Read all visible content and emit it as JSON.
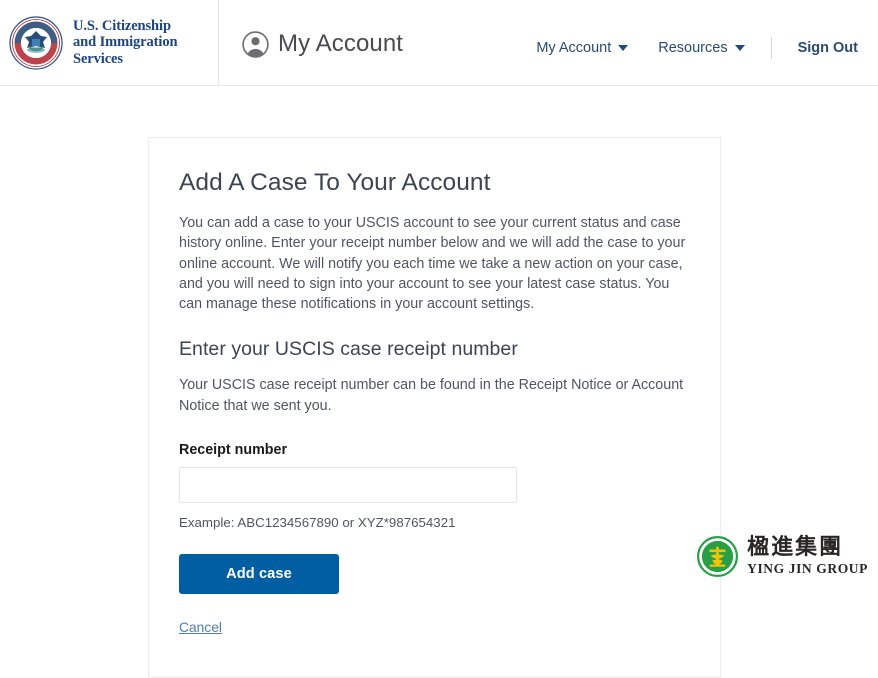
{
  "header": {
    "agency_name_line1": "U.S. Citizenship",
    "agency_name_line2": "and Immigration",
    "agency_name_line3": "Services",
    "seal_icon": "dhs-seal-icon",
    "account_title": "My Account",
    "account_icon": "user-avatar-icon",
    "nav": [
      {
        "label": "My Account",
        "has_dropdown": true,
        "icon": "chevron-down-icon"
      },
      {
        "label": "Resources",
        "has_dropdown": true,
        "icon": "chevron-down-icon"
      }
    ],
    "sign_out_label": "Sign Out"
  },
  "main": {
    "page_title": "Add A Case To Your Account",
    "intro_paragraph": "You can add a case to your USCIS account to see your current status and case history online. Enter your receipt number below and we will add the case to your online account. We will notify you each time we take a new action on your case, and you will need to sign into your account to see your latest case status. You can manage these notifications in your account settings.",
    "section_heading": "Enter your USCIS case receipt number",
    "section_paragraph": "Your USCIS case receipt number can be found in the Receipt Notice or Account Notice that we sent you.",
    "field_label": "Receipt number",
    "receipt_value": "",
    "receipt_placeholder": "",
    "example_text": "Example: ABC1234567890 or XYZ*987654321",
    "submit_label": "Add case",
    "cancel_label": "Cancel"
  },
  "watermark": {
    "logo_icon": "ying-jin-group-logo-icon",
    "chinese_name": "楹進集團",
    "english_name": "YING JIN GROUP"
  },
  "colors": {
    "brand_navy": "#1d4480",
    "nav_link": "#2b4a6f",
    "primary_button": "#005ea2",
    "heading_gray": "#3d4551",
    "body_gray": "#51565e",
    "link_blue": "#4f7fae",
    "card_border": "#ececee",
    "watermark_green": "#1f9c40",
    "watermark_gold": "#f2c200"
  }
}
